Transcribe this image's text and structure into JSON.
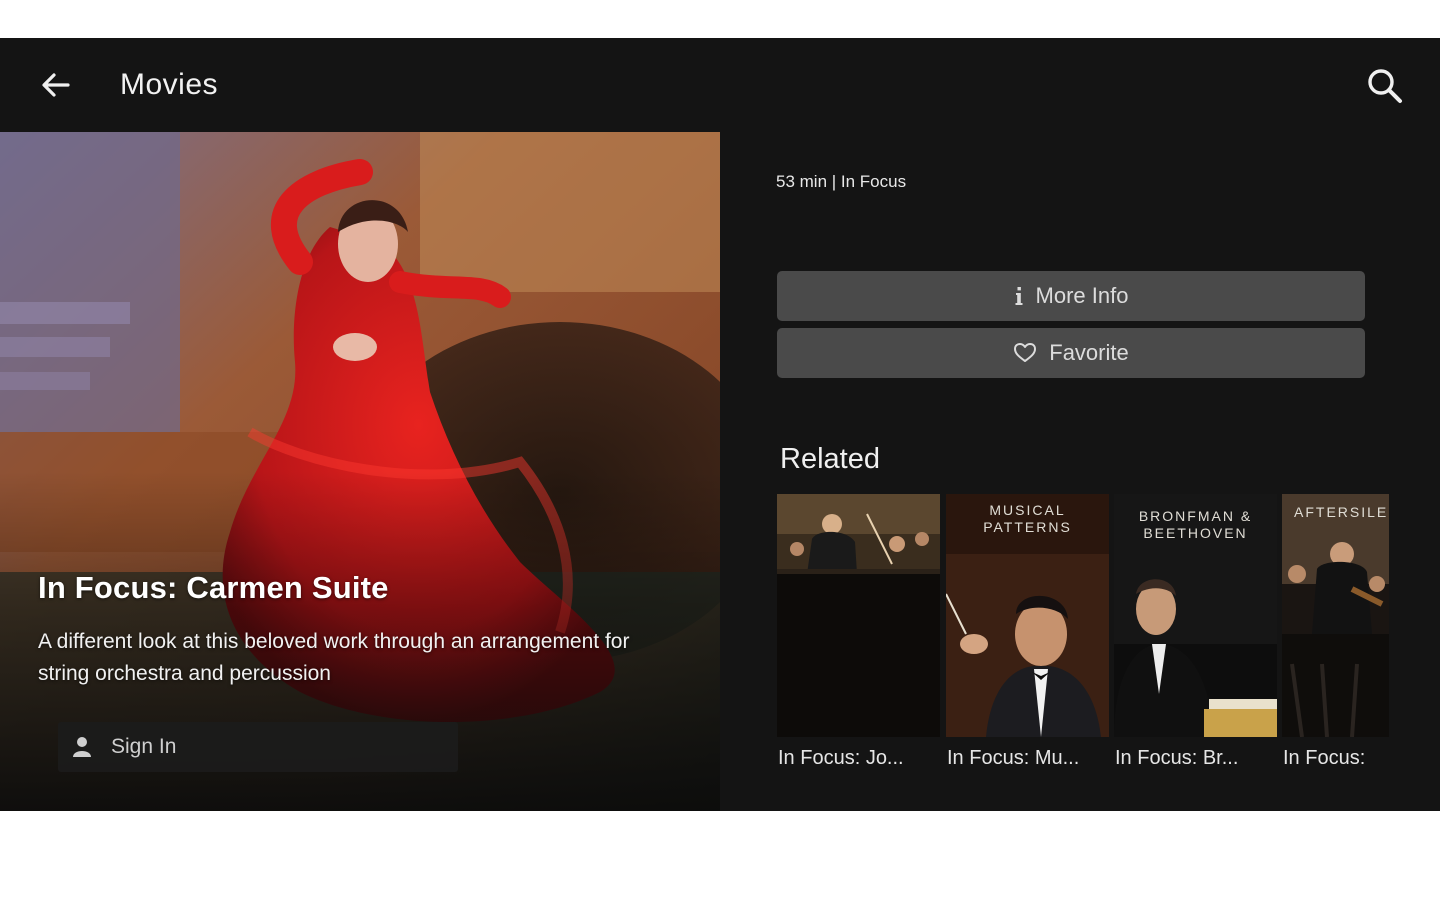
{
  "header": {
    "title": "Movies"
  },
  "hero": {
    "title": "In Focus: Carmen Suite",
    "description": "A different look at this beloved work through an arrangement for string orchestra and percussion",
    "signin_label": "Sign In"
  },
  "details": {
    "meta": "53 min | In Focus",
    "more_info_label": "More Info",
    "favorite_label": "Favorite"
  },
  "related": {
    "heading": "Related",
    "items": [
      {
        "caption": "In Focus: Jo...",
        "thumb_text": ""
      },
      {
        "caption": "In Focus: Mu...",
        "thumb_text": "MUSICAL PATTERNS"
      },
      {
        "caption": "In Focus: Br...",
        "thumb_text": "BRONFMAN & BEETHOVEN"
      },
      {
        "caption": "In Focus:",
        "thumb_text": "AFTERSILE"
      }
    ]
  },
  "colors": {
    "background": "#141414",
    "button": "#4a4a4a",
    "hero_accent": "#d0121a"
  }
}
